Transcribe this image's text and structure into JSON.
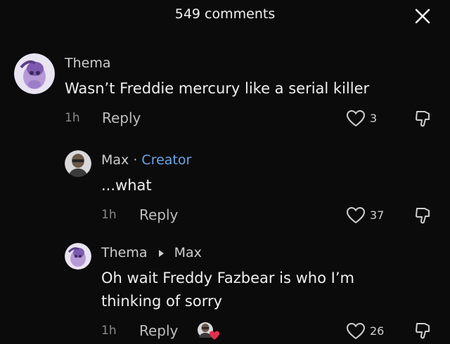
{
  "header": {
    "title": "549 comments",
    "close_icon": "close-icon"
  },
  "comments": [
    {
      "author": "Thema",
      "text": "Wasn’t Freddie mercury like a serial killer",
      "time": "1h",
      "reply_label": "Reply",
      "likes": "3"
    },
    {
      "author": "Max",
      "separator": "·",
      "badge": "Creator",
      "text": "...what",
      "time": "1h",
      "reply_label": "Reply",
      "likes": "37"
    },
    {
      "author": "Thema",
      "reply_to": "Max",
      "text_line1": "Oh wait Freddy Fazbear is who I’m",
      "text_line2": "thinking of sorry",
      "time": "1h",
      "reply_label": "Reply",
      "likes": "26"
    }
  ],
  "colors": {
    "background": "#0b0b0b",
    "creator_badge": "#6aa6e8",
    "liked_by_creator_heart": "#e0304e"
  }
}
